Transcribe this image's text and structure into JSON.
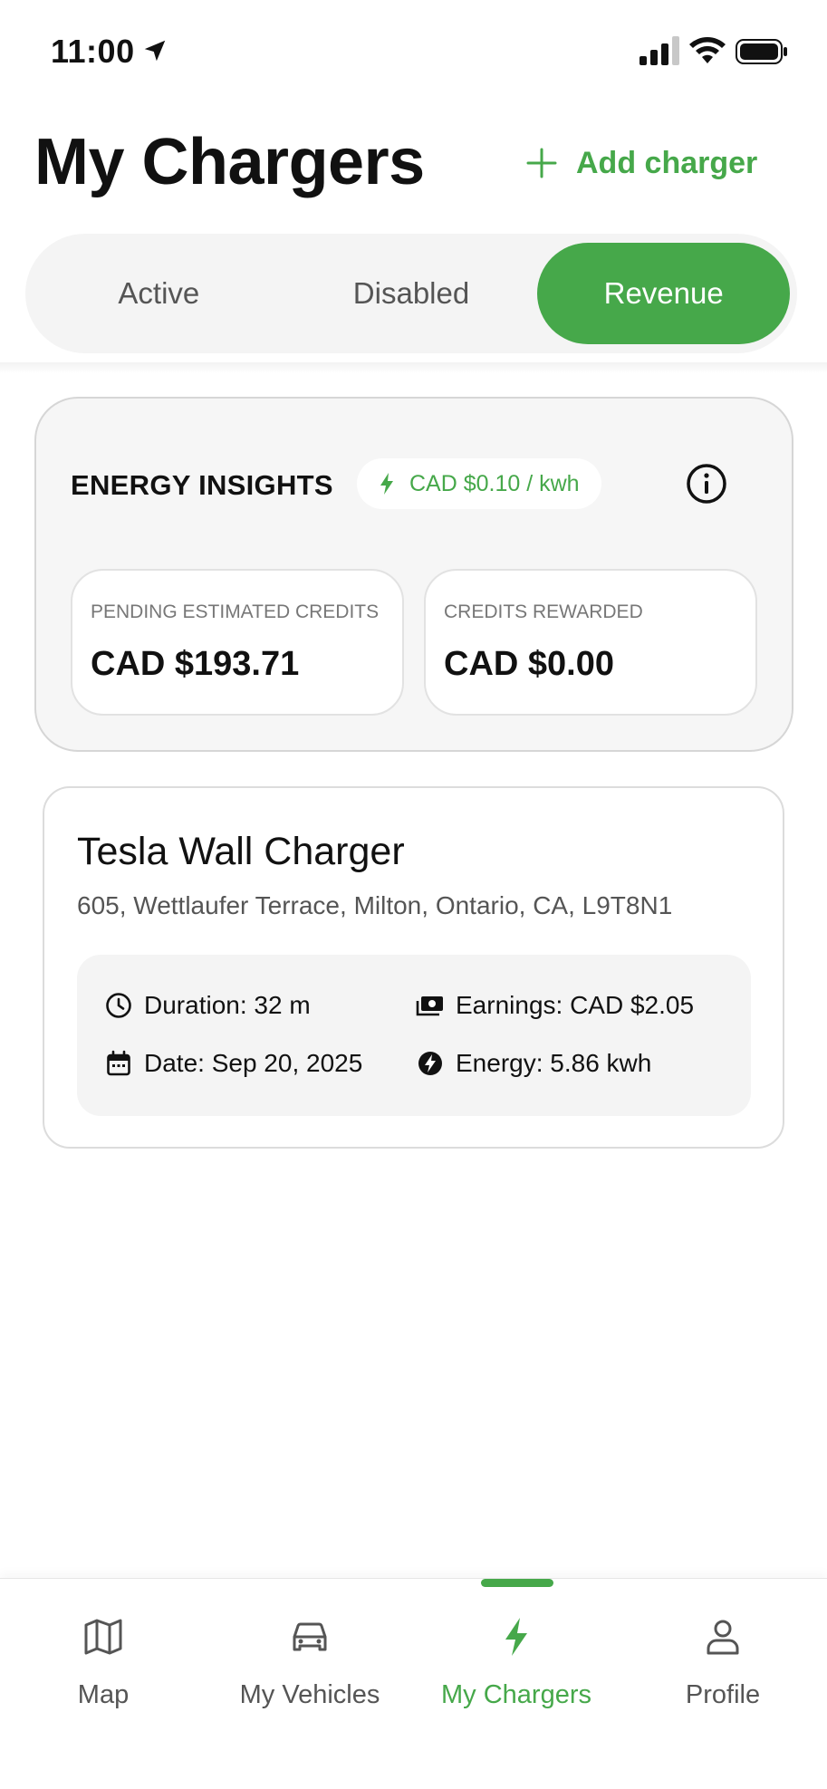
{
  "status_bar": {
    "time": "11:00"
  },
  "header": {
    "title": "My Chargers",
    "add_label": "Add charger"
  },
  "tabs": [
    {
      "label": "Active",
      "selected": false
    },
    {
      "label": "Disabled",
      "selected": false
    },
    {
      "label": "Revenue",
      "selected": true
    }
  ],
  "insights": {
    "title": "ENERGY INSIGHTS",
    "rate": "CAD $0.10 / kwh",
    "pending": {
      "label": "PENDING ESTIMATED CREDITS",
      "value": "CAD $193.71"
    },
    "rewarded": {
      "label": "CREDITS REWARDED",
      "value": "CAD $0.00"
    }
  },
  "charger": {
    "name": "Tesla Wall Charger",
    "address": "605, Wettlaufer Terrace, Milton, Ontario, CA, L9T8N1",
    "duration": "Duration: 32 m",
    "earnings": "Earnings: CAD $2.05",
    "date": "Date: Sep 20, 2025",
    "energy": "Energy: 5.86 kwh"
  },
  "nav": [
    {
      "label": "Map",
      "icon": "map-icon"
    },
    {
      "label": "My Vehicles",
      "icon": "car-icon"
    },
    {
      "label": "My Chargers",
      "icon": "bolt-icon",
      "active": true
    },
    {
      "label": "Profile",
      "icon": "person-icon"
    }
  ],
  "colors": {
    "accent": "#46a84a",
    "text": "#111111",
    "muted": "#555555"
  }
}
